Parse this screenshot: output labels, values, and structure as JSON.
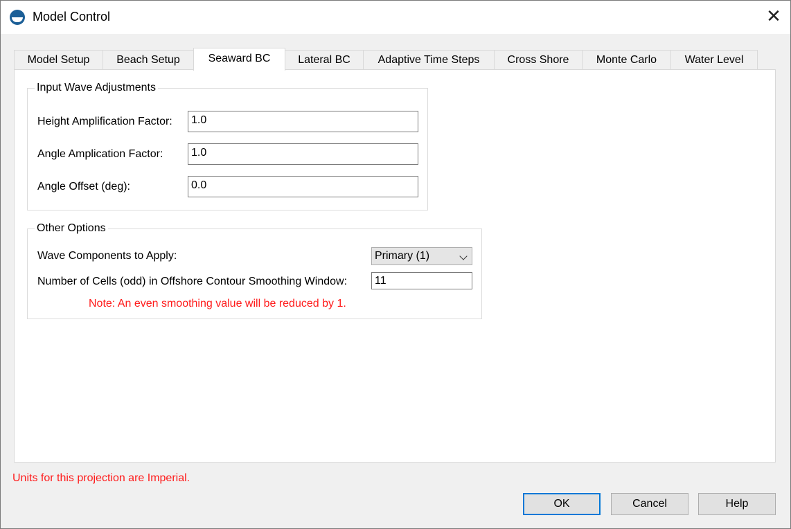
{
  "window": {
    "title": "Model Control",
    "close_glyph": "✕"
  },
  "tabs": [
    {
      "label": "Model Setup",
      "active": false
    },
    {
      "label": "Beach Setup",
      "active": false
    },
    {
      "label": "Seaward BC",
      "active": true
    },
    {
      "label": "Lateral BC",
      "active": false
    },
    {
      "label": "Adaptive Time Steps",
      "active": false
    },
    {
      "label": "Cross Shore",
      "active": false
    },
    {
      "label": "Monte Carlo",
      "active": false
    },
    {
      "label": "Water Level",
      "active": false
    }
  ],
  "input_wave": {
    "title": "Input Wave Adjustments",
    "height_label": "Height Amplification Factor:",
    "height_value": "1.0",
    "angle_label": "Angle Amplication Factor:",
    "angle_value": "1.0",
    "offset_label": "Angle Offset (deg):",
    "offset_value": "0.0"
  },
  "other_options": {
    "title": "Other Options",
    "components_label": "Wave Components to Apply:",
    "components_value": "Primary (1)",
    "cells_label": "Number of Cells (odd) in Offshore Contour Smoothing Window:",
    "cells_value": "11",
    "note": "Note: An even smoothing value will be reduced by 1."
  },
  "units_note": "Units for this projection are Imperial.",
  "buttons": {
    "ok": "OK",
    "cancel": "Cancel",
    "help": "Help"
  },
  "colors": {
    "accent": "#0078d7",
    "warning_text": "#ff1a1a",
    "app_icon": "#1c5f97"
  }
}
